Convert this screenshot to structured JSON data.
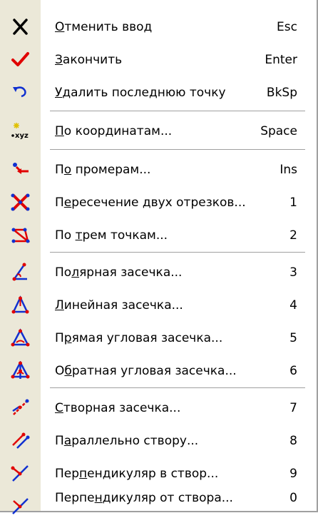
{
  "menu": {
    "items": [
      {
        "pre": "",
        "u": "О",
        "post": "тменить ввод",
        "shortcut": "Esc",
        "icon": "cancel-x-icon"
      },
      {
        "pre": "",
        "u": "З",
        "post": "акончить",
        "shortcut": "Enter",
        "icon": "checkmark-icon"
      },
      {
        "pre": "",
        "u": "У",
        "post": "далить последнюю точку",
        "shortcut": "BkSp",
        "icon": "undo-arrow-icon"
      },
      {
        "pre": "",
        "u": "П",
        "post": "о координатам...",
        "shortcut": "Space",
        "icon": "xyz-coordinates-icon"
      },
      {
        "pre": "П",
        "u": "о",
        "post": " промерам...",
        "shortcut": "Ins",
        "icon": "measure-point-icon"
      },
      {
        "pre": "П",
        "u": "е",
        "post": "ресечение двух отрезков...",
        "shortcut": "1",
        "icon": "segment-intersection-icon"
      },
      {
        "pre": "По ",
        "u": "т",
        "post": "рем точкам...",
        "shortcut": "2",
        "icon": "three-points-icon"
      },
      {
        "pre": "По",
        "u": "л",
        "post": "ярная засечка...",
        "shortcut": "3",
        "icon": "polar-resection-icon"
      },
      {
        "pre": "",
        "u": "Л",
        "post": "инейная засечка...",
        "shortcut": "4",
        "icon": "linear-resection-icon"
      },
      {
        "pre": "П",
        "u": "р",
        "post": "ямая угловая засечка...",
        "shortcut": "5",
        "icon": "direct-angular-resection-icon"
      },
      {
        "pre": "О",
        "u": "б",
        "post": "ратная угловая засечка...",
        "shortcut": "6",
        "icon": "inverse-angular-resection-icon"
      },
      {
        "pre": "",
        "u": "С",
        "post": "творная засечка...",
        "shortcut": "7",
        "icon": "alignment-resection-icon"
      },
      {
        "pre": "П",
        "u": "а",
        "post": "раллельно створу...",
        "shortcut": "8",
        "icon": "parallel-alignment-icon"
      },
      {
        "pre": "Пер",
        "u": "п",
        "post": "ендикуляр в створ...",
        "shortcut": "9",
        "icon": "perpendicular-to-alignment-icon"
      },
      {
        "pre": "Перпе",
        "u": "н",
        "post": "дикуляр от створа...",
        "shortcut": "0",
        "icon": "perpendicular-from-alignment-icon"
      }
    ],
    "icon_text": {
      "xyz": "xyz"
    }
  },
  "colors": {
    "accent_red": "#e00000",
    "accent_blue": "#1030d0",
    "icon_strip": "#ebe8d8"
  }
}
